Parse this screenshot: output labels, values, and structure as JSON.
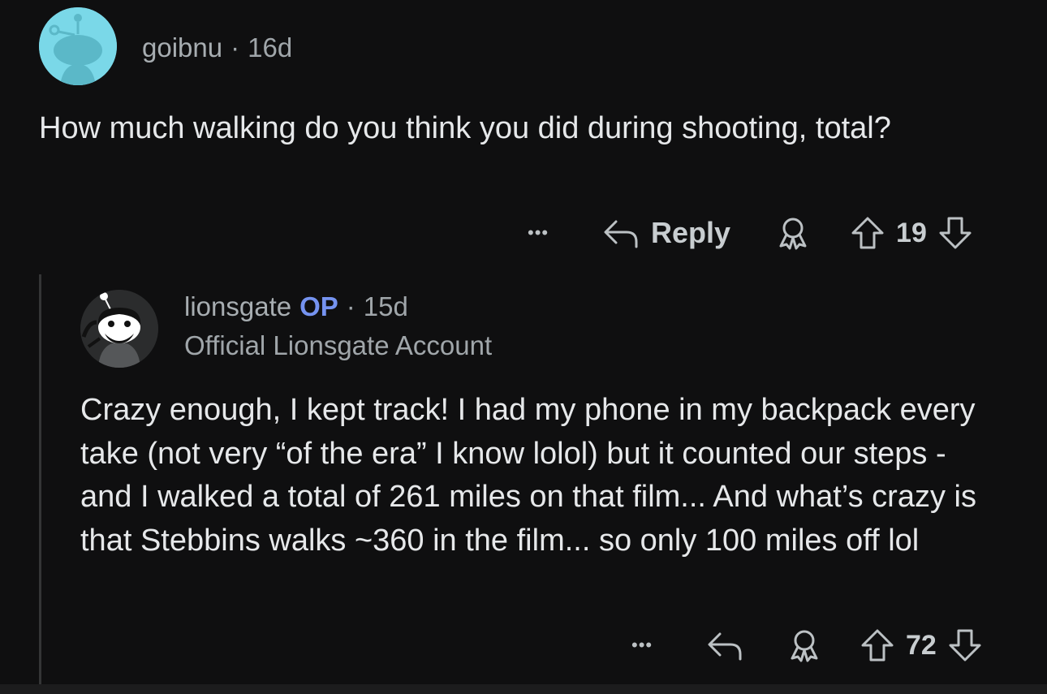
{
  "comments": [
    {
      "username": "goibnu",
      "age": "16d",
      "body": "How much walking do you think you did during shooting, total?",
      "actions": {
        "more": "•••",
        "reply_label": "Reply",
        "score": "19"
      }
    },
    {
      "username": "lionsgate",
      "op_badge": "OP",
      "age": "15d",
      "flair": "Official Lionsgate Account",
      "body": "Crazy enough, I kept track! I had my phone in my backpack every take (not very “of the era” I know lolol) but it counted our steps - and I walked a total of 261 miles on that film... And what’s crazy is that Stebbins walks ~360 in the film... so only 100 miles off lol",
      "actions": {
        "more": "•••",
        "score": "72"
      }
    }
  ],
  "colors": {
    "background": "#0f0f10",
    "op_badge": "#7593f0",
    "avatar_bg": "#7ad8e8"
  },
  "icons": [
    "snoo-avatar-icon",
    "lionsgate-avatar-icon",
    "more-icon",
    "reply-icon",
    "award-icon",
    "upvote-icon",
    "downvote-icon"
  ]
}
